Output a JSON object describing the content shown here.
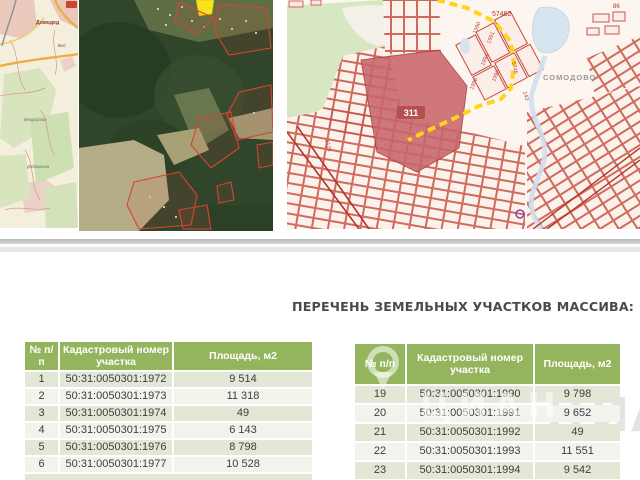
{
  "section": {
    "title": "ПЕРЕЧЕНЬ ЗЕМЕЛЬНЫХ УЧАСТКОВ МАССИВА:"
  },
  "watermark": {
    "brand": "ЦИАН"
  },
  "maps": {
    "topographic": {
      "labels": {
        "town": "Домодед",
        "district": "Вос",
        "village_1": "Мещерское",
        "village_2": "Добрыниха"
      }
    },
    "cadastral": {
      "massif_number": "311",
      "quarter_number": "57462",
      "road_number": "86",
      "settlement": "СОМОДОВО",
      "parcel_numbers": [
        "1990",
        "1991",
        "1994",
        "1996",
        "1998",
        "5746",
        "143",
        "2129"
      ]
    }
  },
  "tables": [
    {
      "headers": [
        "№ п/п",
        "Кадастровый номер участка",
        "Площадь, м2"
      ],
      "rows": [
        [
          "1",
          "50:31:0050301:1972",
          "9 514"
        ],
        [
          "2",
          "50:31:0050301:1973",
          "11 318"
        ],
        [
          "3",
          "50:31:0050301:1974",
          "49"
        ],
        [
          "4",
          "50:31:0050301:1975",
          "6 143"
        ],
        [
          "5",
          "50:31:0050301:1976",
          "8 798"
        ],
        [
          "6",
          "50:31:0050301:1977",
          "10 528"
        ]
      ]
    },
    {
      "headers": [
        "№ п/п",
        "Кадастровый номер участка",
        "Площадь, м2"
      ],
      "rows": [
        [
          "19",
          "50:31:0050301:1990",
          "9 798"
        ],
        [
          "20",
          "50:31:0050301:1991",
          "9 652"
        ],
        [
          "21",
          "50:31:0050301:1992",
          "49"
        ],
        [
          "22",
          "50:31:0050301:1993",
          "11 551"
        ],
        [
          "23",
          "50:31:0050301:1994",
          "9 542"
        ]
      ]
    }
  ],
  "colors": {
    "table_header_green": "#94b55e",
    "row_odd": "#e3e7d6",
    "row_even": "#f1f4ec",
    "cadastral_red": "#c5483a",
    "boundary_yellow": "#ffd516",
    "massif_fill": "#c9666b"
  }
}
